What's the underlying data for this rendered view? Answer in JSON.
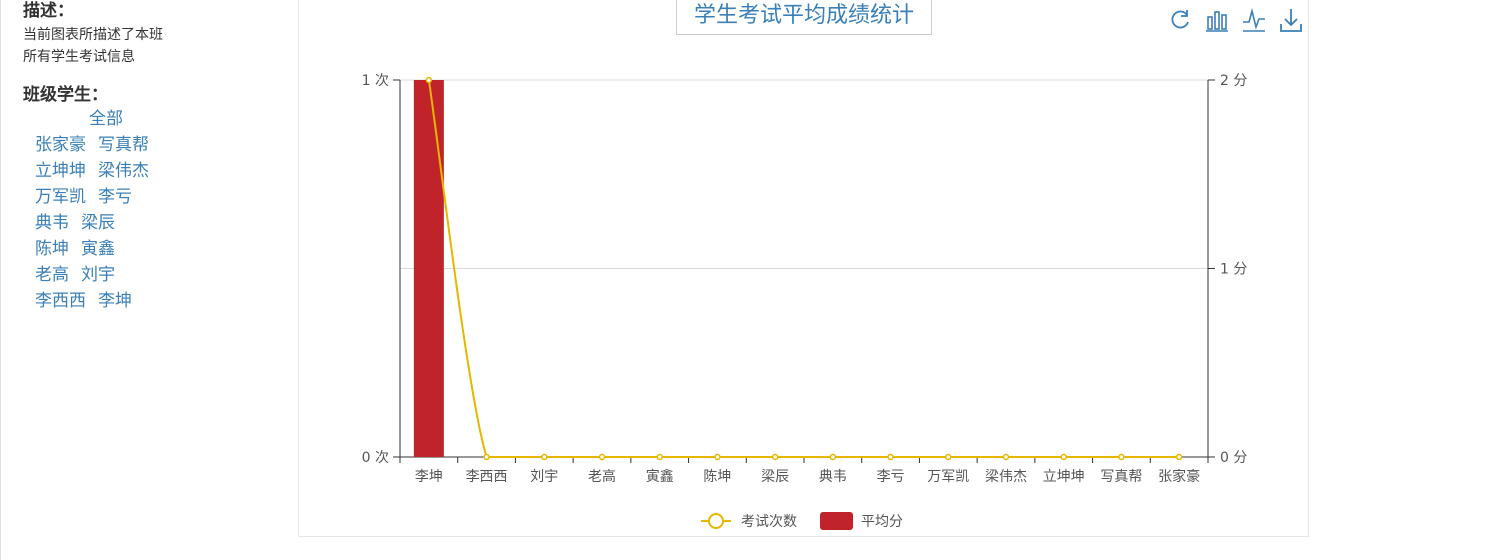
{
  "sidebar": {
    "desc_heading": "描述：",
    "desc_text": "当前图表所描述了本班 所有学生考试信息",
    "students_heading": "班级学生：",
    "all_label": "全部",
    "students": [
      "张家豪",
      "写真帮",
      "立坤坤",
      "梁伟杰",
      "万军凯",
      "李亏",
      "典韦",
      "梁辰",
      "陈坤",
      "寅鑫",
      "老高",
      "刘宇",
      "李西西",
      "李坤"
    ]
  },
  "chart_data": {
    "type": "bar",
    "title": "学生考试平均成绩统计",
    "categories": [
      "李坤",
      "李西西",
      "刘宇",
      "老高",
      "寅鑫",
      "陈坤",
      "梁辰",
      "典韦",
      "李亏",
      "万军凯",
      "梁伟杰",
      "立坤坤",
      "写真帮",
      "张家豪"
    ],
    "series": [
      {
        "name": "考试次数",
        "type": "line",
        "axis": "left",
        "color": "#e6b600",
        "values": [
          1,
          0,
          0,
          0,
          0,
          0,
          0,
          0,
          0,
          0,
          0,
          0,
          0,
          0
        ]
      },
      {
        "name": "平均分",
        "type": "bar",
        "axis": "right",
        "color": "#c1232b",
        "values": [
          2,
          0,
          0,
          0,
          0,
          0,
          0,
          0,
          0,
          0,
          0,
          0,
          0,
          0
        ]
      }
    ],
    "y_left": {
      "ticks": [
        "0 次",
        "1 次"
      ],
      "range": [
        0,
        1
      ]
    },
    "y_right": {
      "ticks": [
        "0 分",
        "1 分",
        "2 分"
      ],
      "range": [
        0,
        2
      ]
    },
    "grid": true,
    "legend_position": "bottom-center",
    "toolbox": [
      "restore-icon",
      "bar-chart-icon",
      "line-chart-icon",
      "download-icon"
    ]
  }
}
